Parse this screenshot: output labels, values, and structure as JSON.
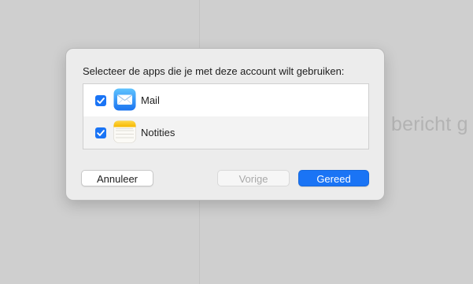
{
  "background": {
    "text": "bericht g"
  },
  "dialog": {
    "prompt": "Selecteer de apps die je met deze account wilt gebruiken:",
    "apps": [
      {
        "label": "Mail",
        "checked": true,
        "icon": "mail-app-icon"
      },
      {
        "label": "Notities",
        "checked": true,
        "icon": "notes-app-icon"
      }
    ],
    "buttons": {
      "cancel": "Annuleer",
      "previous": "Vorige",
      "done": "Gereed"
    }
  },
  "colors": {
    "accent": "#1a74f5",
    "backdrop": "#cfcfcf",
    "sheet": "#ececec"
  }
}
